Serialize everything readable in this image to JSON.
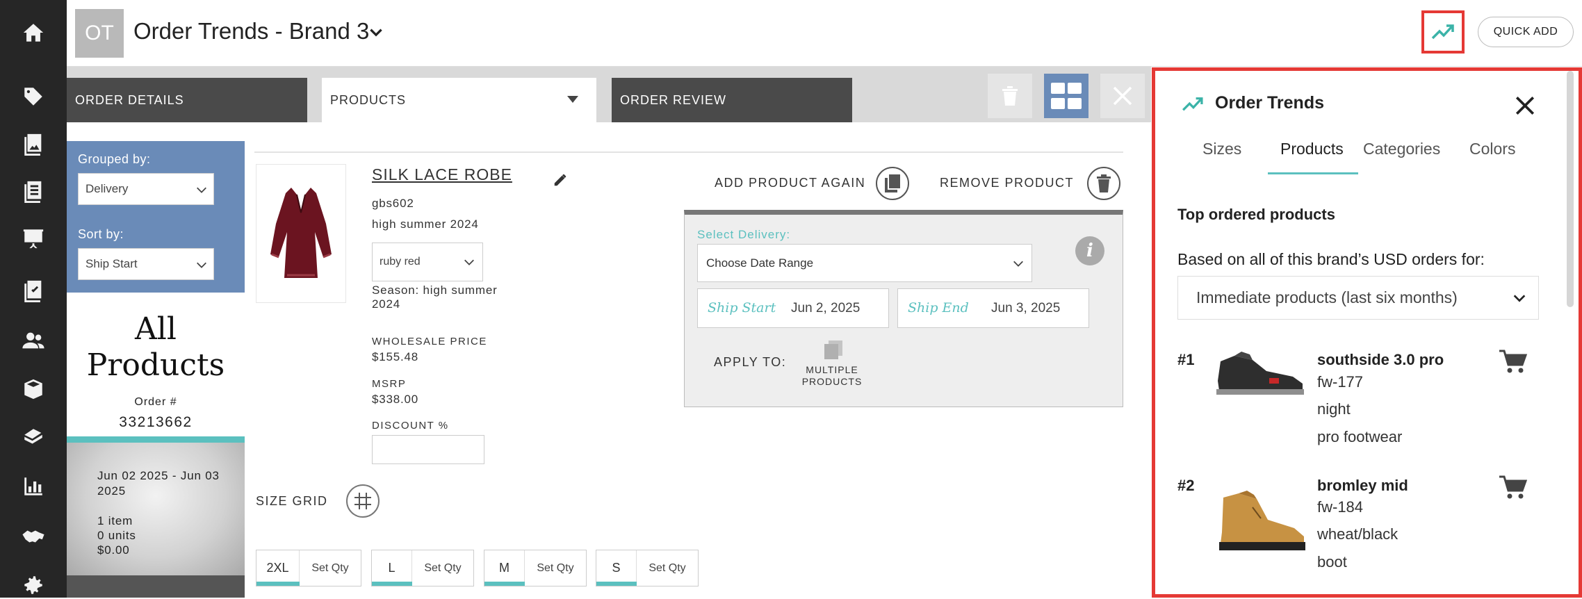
{
  "header": {
    "avatar_initials": "OT",
    "title": "Order Trends - Brand 3",
    "quick_add_label": "QUICK ADD"
  },
  "rail": {
    "icons": [
      "home-icon",
      "tag-icon",
      "catalog-icon",
      "list-icon",
      "presentation-icon",
      "checklist-icon",
      "users-icon",
      "box-icon",
      "shipping-icon",
      "bar-chart-icon",
      "handshake-icon",
      "gear-icon"
    ]
  },
  "tabs": {
    "order_details": "ORDER DETAILS",
    "products": "PRODUCTS",
    "order_review": "ORDER REVIEW"
  },
  "sidebar": {
    "grouped_by_label": "Grouped by:",
    "grouped_by_value": "Delivery",
    "sort_by_label": "Sort by:",
    "sort_by_value": "Ship Start",
    "all_products_line1": "All",
    "all_products_line2": "Products",
    "order_label": "Order #",
    "order_number": "33213662",
    "summary": {
      "date_range_line1": "Jun 02 2025 - Jun 03",
      "date_range_line2": "2025",
      "items": "1 item",
      "units": "0 units",
      "total": "$0.00"
    }
  },
  "product": {
    "name": "SILK LACE ROBE",
    "sku": "gbs602",
    "collection": "high summer 2024",
    "color": "ruby red",
    "season_line1": "Season: high summer",
    "season_line2": "2024",
    "wholesale_label": "WHOLESALE PRICE",
    "wholesale_value": "$155.48",
    "msrp_label": "MSRP",
    "msrp_value": "$338.00",
    "discount_label": "DISCOUNT %",
    "add_again_label": "ADD PRODUCT AGAIN",
    "remove_label": "REMOVE PRODUCT"
  },
  "delivery": {
    "select_label": "Select Delivery:",
    "date_range_value": "Choose Date Range",
    "ship_start_label": "Ship Start",
    "ship_start_value": "Jun 2, 2025",
    "ship_end_label": "Ship End",
    "ship_end_value": "Jun 3, 2025",
    "apply_to_label": "APPLY TO:",
    "multiple_line1": "MULTIPLE",
    "multiple_line2": "PRODUCTS"
  },
  "size_grid": {
    "label": "SIZE GRID",
    "sizes": [
      {
        "size": "2XL",
        "qty_label": "Set Qty"
      },
      {
        "size": "L",
        "qty_label": "Set Qty"
      },
      {
        "size": "M",
        "qty_label": "Set Qty"
      },
      {
        "size": "S",
        "qty_label": "Set Qty"
      }
    ]
  },
  "trends_panel": {
    "title": "Order Trends",
    "tabs": [
      "Sizes",
      "Products",
      "Categories",
      "Colors"
    ],
    "active_tab": "Products",
    "section_title": "Top ordered products",
    "based_on": "Based on all of this brand’s USD orders for:",
    "period": "Immediate products (last six months)",
    "items": [
      {
        "rank": "#1",
        "name": "southside 3.0 pro",
        "sku": "fw-177",
        "color": "night",
        "category": "pro footwear"
      },
      {
        "rank": "#2",
        "name": "bromley mid",
        "sku": "fw-184",
        "color": "wheat/black",
        "category": "boot"
      }
    ]
  },
  "colors": {
    "accent_teal": "#5bc0bf",
    "highlight_red": "#e53935",
    "rail_bg": "#262626",
    "group_panel_blue": "#6a8bb8",
    "tab_dark": "#4a4a4a",
    "grid_button_blue": "#6a8bb8"
  }
}
